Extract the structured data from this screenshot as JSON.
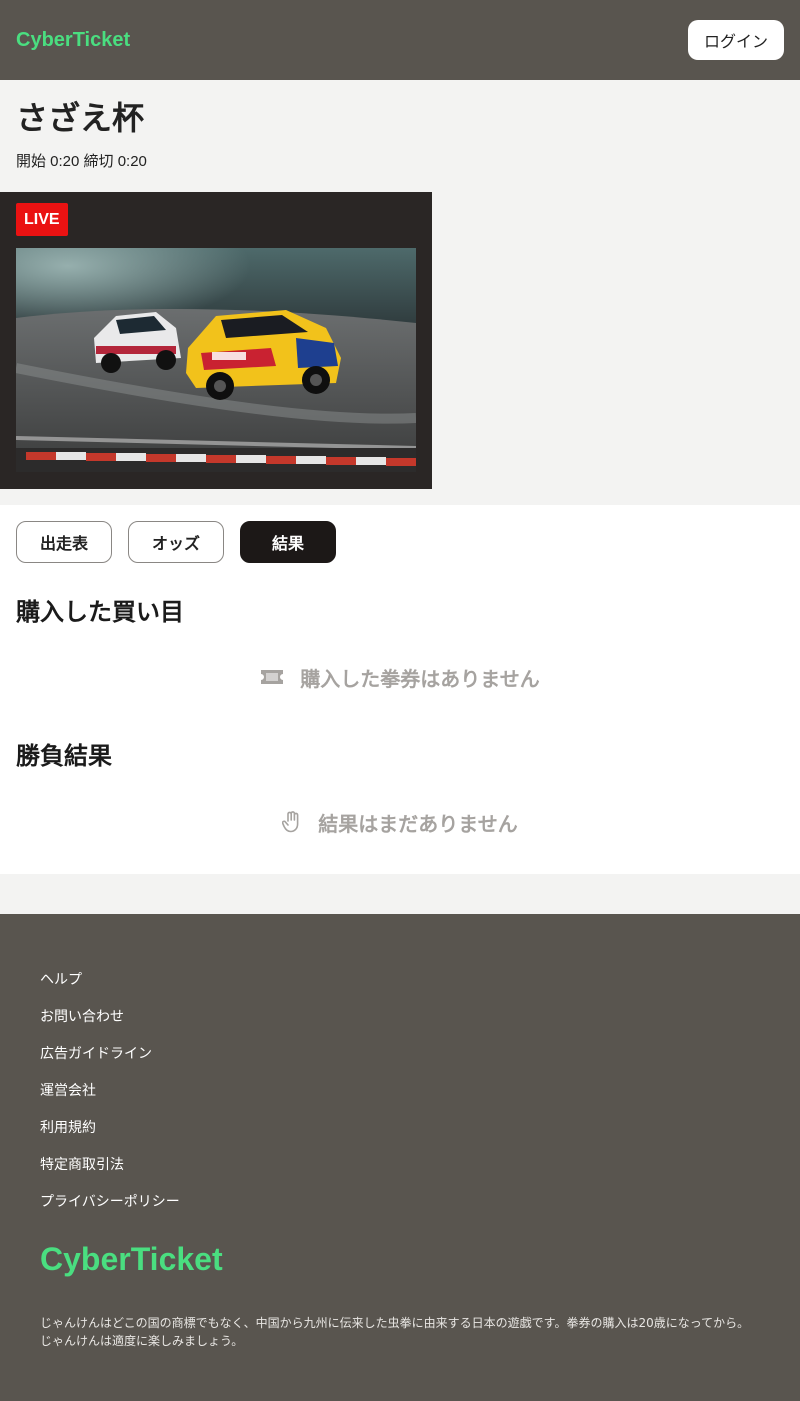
{
  "header": {
    "logo": "CyberTicket",
    "login_label": "ログイン"
  },
  "event": {
    "title": "さざえ杯",
    "time": "開始 0:20 締切 0:20",
    "live_label": "LIVE"
  },
  "tabs": [
    {
      "label": "出走表",
      "active": false
    },
    {
      "label": "オッズ",
      "active": false
    },
    {
      "label": "結果",
      "active": true
    }
  ],
  "purchased": {
    "title": "購入した買い目",
    "empty_icon": "ticket-icon",
    "empty_text": "購入した拳券はありません"
  },
  "results": {
    "title": "勝負結果",
    "empty_icon": "hand-icon",
    "empty_text": "結果はまだありません"
  },
  "footer": {
    "links": [
      "ヘルプ",
      "お問い合わせ",
      "広告ガイドライン",
      "運営会社",
      "利用規約",
      "特定商取引法",
      "プライバシーポリシー"
    ],
    "logo": "CyberTicket",
    "note": "じゃんけんはどこの国の商標でもなく、中国から九州に伝来した虫拳に由来する日本の遊戯です。拳券の購入は20歳になってから。じゃんけんは適度に楽しみましょう。"
  },
  "colors": {
    "brand": "#4ade80",
    "header_bg": "#59554f",
    "live": "#ea1212",
    "active_tab": "#1c1817",
    "muted": "#a6a3a0"
  }
}
